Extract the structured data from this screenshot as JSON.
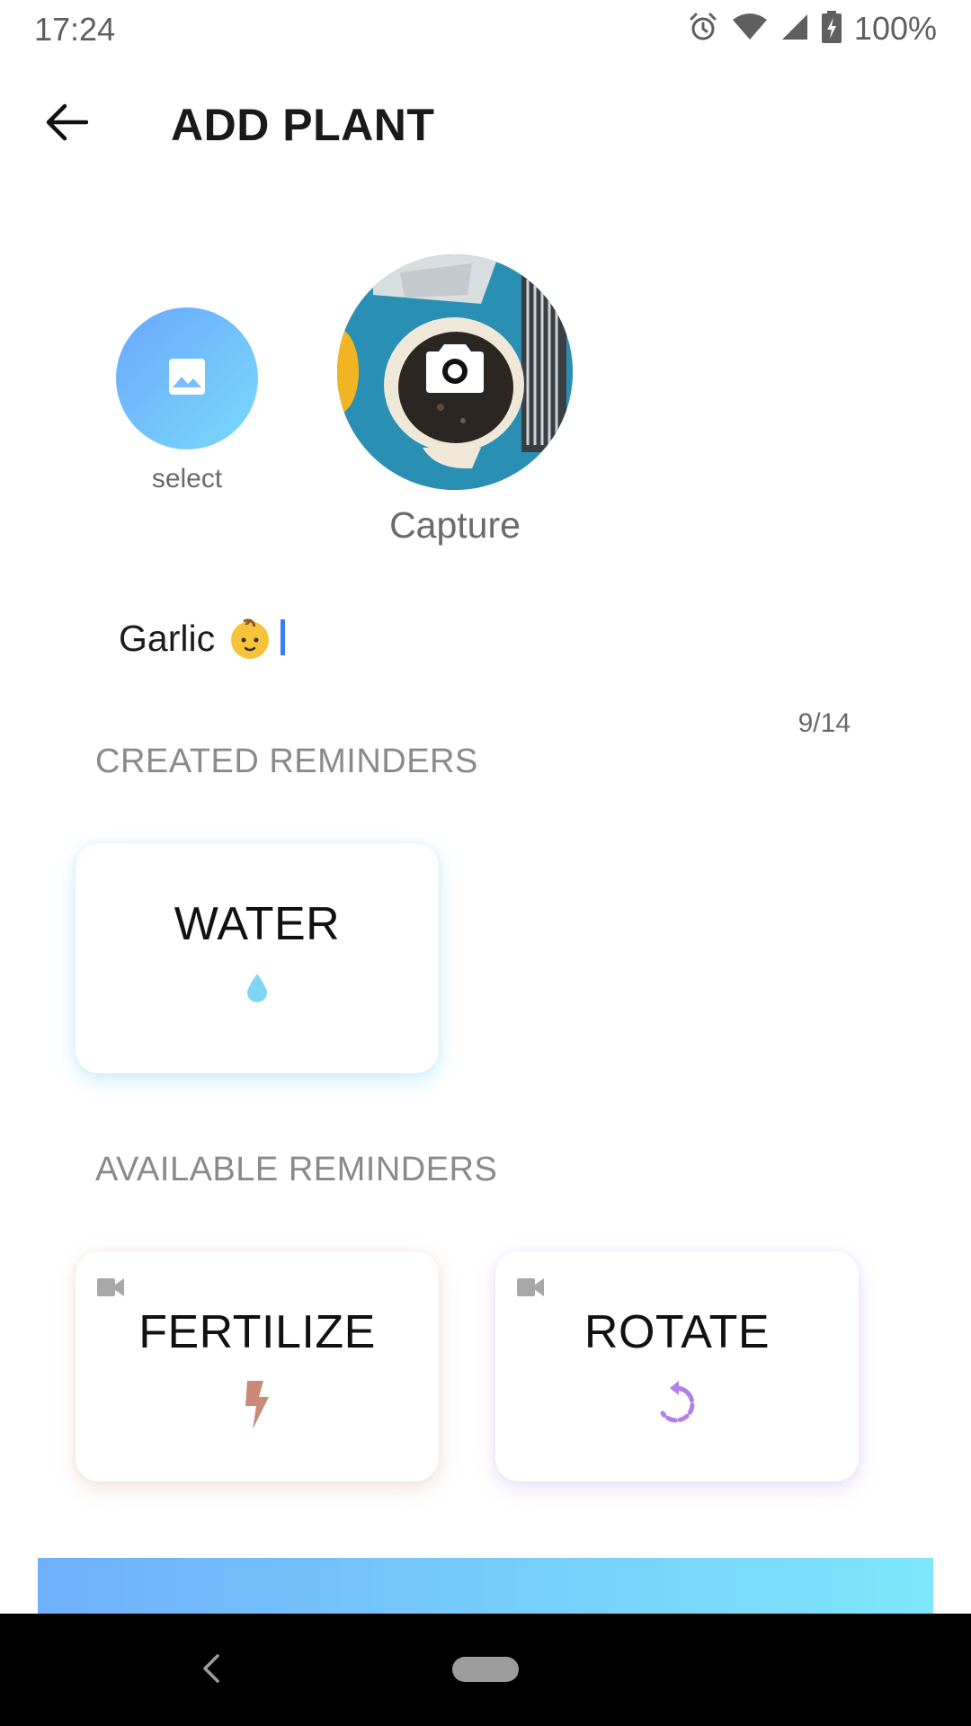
{
  "status_bar": {
    "time": "17:24",
    "battery_percent": "100%",
    "icons": [
      "alarm-icon",
      "wifi-icon",
      "cell-signal-icon",
      "battery-charging-icon"
    ]
  },
  "app_bar": {
    "back_icon": "arrow-left-icon",
    "title": "ADD PLANT"
  },
  "photo": {
    "select_label": "select",
    "select_icon": "image-icon",
    "capture_label": "Capture",
    "capture_icon": "camera-icon"
  },
  "plant_name": {
    "value": "Garlic",
    "emoji_icon": "baby-emoji-icon",
    "counter": "9/14"
  },
  "created_reminders": {
    "title": "CREATED REMINDERS",
    "items": [
      {
        "label": "WATER",
        "icon": "water-drop-icon",
        "color": "#7fd6f3"
      }
    ]
  },
  "available_reminders": {
    "title": "AVAILABLE REMINDERS",
    "items": [
      {
        "label": "FERTILIZE",
        "icon": "lightning-icon",
        "badge_icon": "video-icon",
        "color": "#c98a78"
      },
      {
        "label": "ROTATE",
        "icon": "rotate-icon",
        "badge_icon": "video-icon",
        "color": "#b37ee6"
      }
    ]
  },
  "colors": {
    "accent_gradient_start": "#6fb0fb",
    "accent_gradient_end": "#7de7fb",
    "caret": "#3d7bf7"
  }
}
